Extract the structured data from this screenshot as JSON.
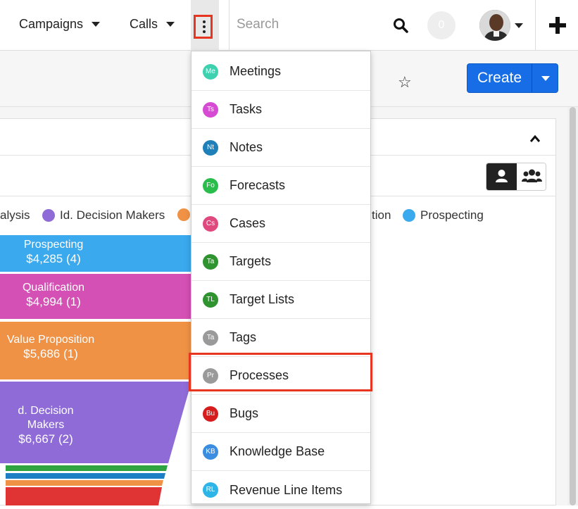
{
  "topbar": {
    "tabs": [
      {
        "label": "Campaigns"
      },
      {
        "label": "Calls"
      }
    ],
    "search_placeholder": "Search",
    "notifications_count": "0"
  },
  "header": {
    "create_label": "Create"
  },
  "legend": [
    "alysis",
    "Id. Decision Makers",
    "tion",
    "Prospecting"
  ],
  "funnel": [
    {
      "stage": "Prospecting",
      "amount": "$4,285 (4)"
    },
    {
      "stage": "Qualification",
      "amount": "$4,994 (1)"
    },
    {
      "stage": "Value Proposition",
      "amount": "$5,686 (1)"
    },
    {
      "stage": "d. Decision Makers",
      "amount": "$6,667 (2)"
    }
  ],
  "menu": [
    {
      "abbr": "Me",
      "label": "Meetings",
      "color": "#3dd1b0"
    },
    {
      "abbr": "Ts",
      "label": "Tasks",
      "color": "#d64bd3"
    },
    {
      "abbr": "Nt",
      "label": "Notes",
      "color": "#1f7fb9"
    },
    {
      "abbr": "Fo",
      "label": "Forecasts",
      "color": "#2bbd4c"
    },
    {
      "abbr": "Cs",
      "label": "Cases",
      "color": "#e0497d"
    },
    {
      "abbr": "Ta",
      "label": "Targets",
      "color": "#2f9430"
    },
    {
      "abbr": "TL",
      "label": "Target Lists",
      "color": "#2f9430"
    },
    {
      "abbr": "Ta",
      "label": "Tags",
      "color": "#9a9a9a"
    },
    {
      "abbr": "Pr",
      "label": "Processes",
      "color": "#9a9a9a"
    },
    {
      "abbr": "Bu",
      "label": "Bugs",
      "color": "#d61d1d"
    },
    {
      "abbr": "KB",
      "label": "Knowledge Base",
      "color": "#3a8de0"
    },
    {
      "abbr": "RL",
      "label": "Revenue Line Items",
      "color": "#2db5e8"
    }
  ],
  "colors": {
    "accent": "#176de5",
    "highlight": "#e8351f",
    "prospecting": "#3aa9ee",
    "qualification": "#d450b4",
    "value_proposition": "#f09245",
    "decision_makers": "#8e6bd6"
  }
}
